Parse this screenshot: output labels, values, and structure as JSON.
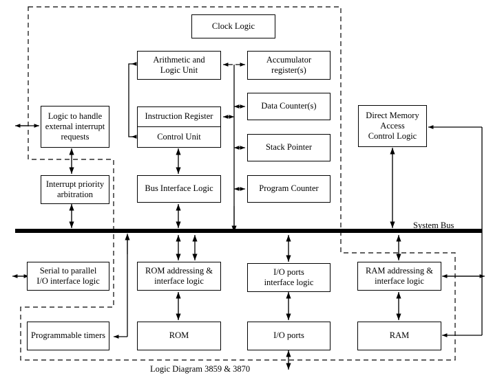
{
  "diagram": {
    "caption": "Logic Diagram 3859 & 3870",
    "bus_label": "System Bus",
    "colors": {
      "line": "#000000",
      "background": "#ffffff",
      "bus": "#000000"
    },
    "boxes": {
      "clock_logic": "Clock Logic",
      "alu_line1": "Arithmetic and",
      "alu_line2": "Logic Unit",
      "accumulator_line1": "Accumulator",
      "accumulator_line2": "register(s)",
      "data_counters": "Data Counter(s)",
      "stack_pointer": "Stack Pointer",
      "program_counter": "Program Counter",
      "instruction_register": "Instruction Register",
      "control_unit": "Control Unit",
      "bus_interface_logic": "Bus Interface Logic",
      "interrupt_logic_line1": "Logic to handle",
      "interrupt_logic_line2": "external interrupt",
      "interrupt_logic_line3": "requests",
      "interrupt_priority_line1": "Interrupt priority",
      "interrupt_priority_line2": "arbitration",
      "dma_line1": "Direct Memory",
      "dma_line2": "Access",
      "dma_line3": "Control Logic",
      "serial_parallel_line1": "Serial to parallel",
      "serial_parallel_line2": "I/O interface logic",
      "rom_addressing_line1": "ROM addressing &",
      "rom_addressing_line2": "interface logic",
      "io_ports_interface_line1": "I/O ports",
      "io_ports_interface_line2": "interface logic",
      "ram_addressing_line1": "RAM addressing &",
      "ram_addressing_line2": "interface logic",
      "programmable_timers": "Programmable timers",
      "rom": "ROM",
      "io_ports": "I/O ports",
      "ram": "RAM"
    }
  }
}
